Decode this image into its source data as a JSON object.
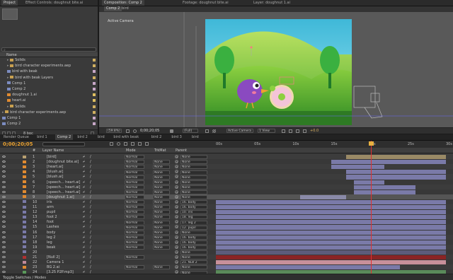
{
  "project_panel": {
    "tabs": [
      "Project",
      "Effect Controls: doughnut bite.ai"
    ],
    "search_placeholder": "",
    "header": "Name",
    "items": [
      {
        "label": "Solids",
        "type": "folder",
        "indent": 1
      },
      {
        "label": "bird character experiments.aep",
        "type": "folder",
        "indent": 1
      },
      {
        "label": "bird with beak",
        "type": "comp",
        "indent": 1
      },
      {
        "label": "bird with beak Layers",
        "type": "folder",
        "indent": 1
      },
      {
        "label": "Comp 1",
        "type": "comp",
        "indent": 1
      },
      {
        "label": "Comp 2",
        "type": "comp",
        "indent": 1
      },
      {
        "label": "doughnut 1.ai",
        "type": "ai",
        "indent": 1
      },
      {
        "label": "heart.ai",
        "type": "ai",
        "indent": 1
      },
      {
        "label": "Solids",
        "type": "folder",
        "indent": 1
      },
      {
        "label": "bird character experiments.aep",
        "type": "folder",
        "indent": 0
      },
      {
        "label": "Comp 1",
        "type": "comp",
        "indent": 0
      },
      {
        "label": "Comp 2",
        "type": "comp",
        "indent": 0
      }
    ],
    "footer": "8 bpc"
  },
  "viewer": {
    "tabs": [
      "Composition: Comp 2",
      "Footage: doughnut bite.ai",
      "Layer: doughnut 1.ai"
    ],
    "subtabs": [
      "Comp 2",
      "bird"
    ],
    "label": "Active Camera",
    "toolbar": {
      "zoom": "(59.8%)",
      "time": "0;00;20;05",
      "quality": "(Full)",
      "camera": "Active Camera",
      "view": "1 View",
      "exposure": "+0.0"
    }
  },
  "timeline": {
    "tabs": [
      "Render Queue",
      "bird 1",
      "Comp 2",
      "bird 2",
      "bird",
      "bird with beak",
      "bird 2",
      "bird 3",
      "bird"
    ],
    "timecode": "0;00;20;05",
    "search_placeholder": "",
    "columns": {
      "num": "#",
      "name": "Layer Name",
      "mode": "Mode",
      "trkmat": "TrkMat",
      "parent": "Parent"
    },
    "ruler": [
      "00s",
      "05s",
      "10s",
      "15s",
      "20s",
      "25s",
      "30s"
    ],
    "playhead_seconds": 20.2,
    "rows": [
      {
        "num": "1",
        "name": "[bird]",
        "mode": "Normal",
        "trkmat": "",
        "parent": "None",
        "color": "#b8a070",
        "bar_start": 17,
        "bar_end": 30,
        "bar_color": "#9a8a66"
      },
      {
        "num": "2",
        "name": "[doughnut bite.ai]",
        "mode": "Normal",
        "trkmat": "None",
        "parent": "None",
        "color": "#e08a30",
        "bar_start": 15,
        "bar_end": 30,
        "bar_color": "#7a7aa8"
      },
      {
        "num": "3",
        "name": "[heart.ai]",
        "mode": "Normal",
        "trkmat": "None",
        "parent": "None",
        "color": "#e08a30",
        "bar_start": 15,
        "bar_end": 22,
        "bar_color": "#7a7aa8"
      },
      {
        "num": "4",
        "name": "[blush.ai]",
        "mode": "Normal",
        "trkmat": "None",
        "parent": "None",
        "color": "#e08a30",
        "bar_start": 17,
        "bar_end": 30,
        "bar_color": "#7a7aa8"
      },
      {
        "num": "5",
        "name": "[blush.ai]",
        "mode": "Normal",
        "trkmat": "None",
        "parent": "None",
        "color": "#e08a30",
        "bar_start": 17,
        "bar_end": 30,
        "bar_color": "#7a7aa8"
      },
      {
        "num": "6",
        "name": "[speech... heart.ai]",
        "mode": "Normal",
        "trkmat": "None",
        "parent": "None",
        "color": "#e08a30",
        "bar_start": 18,
        "bar_end": 22,
        "bar_color": "#7a7aa8"
      },
      {
        "num": "7",
        "name": "[speech... heart.ai]",
        "mode": "Normal",
        "trkmat": "None",
        "parent": "None",
        "color": "#e08a30",
        "bar_start": 18,
        "bar_end": 26,
        "bar_color": "#7a7aa8"
      },
      {
        "num": "8",
        "name": "[speech... heart.ai]",
        "mode": "Normal",
        "trkmat": "None",
        "parent": "None",
        "color": "#e08a30",
        "bar_start": 18,
        "bar_end": 26,
        "bar_color": "#7a7aa8"
      },
      {
        "num": "9",
        "name": "[doughnut 1.ai]",
        "mode": "Normal",
        "trkmat": "None",
        "parent": "None",
        "color": "#e08a30",
        "bar_start": 11,
        "bar_end": 17,
        "bar_color": "#8a8aa8",
        "selected": true
      },
      {
        "num": "10",
        "name": "iris",
        "mode": "Normal",
        "trkmat": "None",
        "parent": "16. body",
        "color": "#7a7aa8",
        "bar_start": 0,
        "bar_end": 30,
        "bar_color": "#7a7aa8"
      },
      {
        "num": "11",
        "name": "arm",
        "mode": "Normal",
        "trkmat": "None",
        "parent": "16. body",
        "color": "#7a7aa8",
        "bar_start": 0,
        "bar_end": 30,
        "bar_color": "#7a7aa8"
      },
      {
        "num": "12",
        "name": "pupil",
        "mode": "Normal",
        "trkmat": "None",
        "parent": "10. iris",
        "color": "#7a7aa8",
        "bar_start": 0,
        "bar_end": 30,
        "bar_color": "#7a7aa8"
      },
      {
        "num": "13",
        "name": "foot 2",
        "mode": "Normal",
        "trkmat": "None",
        "parent": "18. leg",
        "color": "#7a7aa8",
        "bar_start": 0,
        "bar_end": 30,
        "bar_color": "#7a7aa8"
      },
      {
        "num": "14",
        "name": "foot",
        "mode": "Normal",
        "trkmat": "None",
        "parent": "17. leg 2",
        "color": "#7a7aa8",
        "bar_start": 0,
        "bar_end": 30,
        "bar_color": "#7a7aa8"
      },
      {
        "num": "15",
        "name": "Lashes",
        "mode": "Normal",
        "trkmat": "None",
        "parent": "12. pupil",
        "color": "#7a7aa8",
        "bar_start": 0,
        "bar_end": 30,
        "bar_color": "#7a7aa8"
      },
      {
        "num": "16",
        "name": "body",
        "mode": "Normal",
        "trkmat": "None",
        "parent": "None",
        "color": "#7a7aa8",
        "bar_start": 0,
        "bar_end": 30,
        "bar_color": "#7a7aa8"
      },
      {
        "num": "17",
        "name": "leg 2",
        "mode": "Normal",
        "trkmat": "None",
        "parent": "16. body",
        "color": "#7a7aa8",
        "bar_start": 0,
        "bar_end": 30,
        "bar_color": "#7a7aa8"
      },
      {
        "num": "18",
        "name": "leg",
        "mode": "Normal",
        "trkmat": "None",
        "parent": "16. body",
        "color": "#7a7aa8",
        "bar_start": 0,
        "bar_end": 30,
        "bar_color": "#7a7aa8"
      },
      {
        "num": "19",
        "name": "beak",
        "mode": "Normal",
        "trkmat": "None",
        "parent": "16. body",
        "color": "#7a7aa8",
        "bar_start": 0,
        "bar_end": 30,
        "bar_color": "#7a7aa8"
      },
      {
        "num": "20",
        "name": "",
        "mode": "",
        "trkmat": "",
        "parent": "None",
        "color": "#7a7aa8",
        "bar_start": 0,
        "bar_end": 30,
        "bar_color": "#5c5c7a"
      },
      {
        "num": "21",
        "name": "[Null 2]",
        "mode": "Normal",
        "trkmat": "",
        "parent": "None",
        "color": "#b03030",
        "bar_start": 0,
        "bar_end": 30,
        "bar_color": "#8a2424"
      },
      {
        "num": "22",
        "name": "Camera 1",
        "mode": "",
        "trkmat": "",
        "parent": "21. Null 2",
        "color": "#c08a9a",
        "bar_start": 0,
        "bar_end": 30,
        "bar_color": "#c8909a"
      },
      {
        "num": "23",
        "name": "BG 2.ai",
        "mode": "Normal",
        "trkmat": "None",
        "parent": "None",
        "color": "#e08a30",
        "bar_start": 0,
        "bar_end": 24,
        "bar_color": "#7a7aa8"
      },
      {
        "num": "24",
        "name": "[3.25 P2P.mp3]",
        "mode": "",
        "trkmat": "",
        "parent": "None",
        "color": "#5a9a5a",
        "bar_start": 0,
        "bar_end": 30,
        "bar_color": "#5a8a5a"
      }
    ],
    "footer": "Toggle Switches / Modes"
  }
}
